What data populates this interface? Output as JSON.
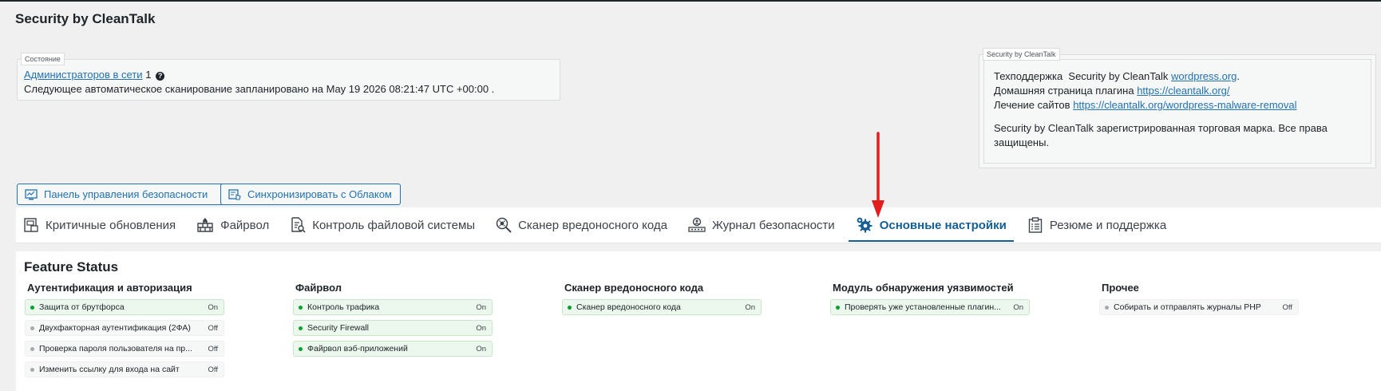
{
  "page": {
    "title": "Security by CleanTalk"
  },
  "status": {
    "legend": "Состояние",
    "admins_link": "Администраторов в сети",
    "admins_count": "1",
    "scan_text": "Следующее автоматическое сканирование запланировано на May 19 2026 08:21:47 UTC +00:00 ."
  },
  "info": {
    "legend": "Security by CleanTalk",
    "support_label": "Техподдержка  Security by CleanTalk",
    "support_link": "wordpress.org",
    "home_label": "Домашняя страница плагина",
    "home_link": "https://cleantalk.org/",
    "repair_label": "Лечение сайтов",
    "repair_link": "https://cleantalk.org/wordpress-malware-removal",
    "trademark": "Security by CleanTalk зарегистрированная торговая марка. Все права защищены."
  },
  "buttons": {
    "dashboard": "Панель управления безопасности",
    "sync": "Синхронизировать с Облаком"
  },
  "tabs": [
    {
      "label": "Критичные обновления",
      "icon": "critical-updates-icon"
    },
    {
      "label": "Файрвол",
      "icon": "firewall-icon"
    },
    {
      "label": "Контроль файловой системы",
      "icon": "file-control-icon"
    },
    {
      "label": "Сканер вредоносного кода",
      "icon": "malware-scanner-icon"
    },
    {
      "label": "Журнал безопасности",
      "icon": "security-log-icon"
    },
    {
      "label": "Основные настройки",
      "icon": "gear-icon",
      "active": true
    },
    {
      "label": "Резюме и поддержка",
      "icon": "clipboard-icon"
    }
  ],
  "features": {
    "title": "Feature Status",
    "columns": [
      {
        "title": "Аутентификация и авторизация",
        "items": [
          {
            "name": "Защита от брутфорса",
            "state": "On"
          },
          {
            "name": "Двухфакторная аутентификация (2ФА)",
            "state": "Off"
          },
          {
            "name": "Проверка пароля пользователя на пр...",
            "state": "Off"
          },
          {
            "name": "Изменить ссылку для входа на сайт",
            "state": "Off"
          }
        ]
      },
      {
        "title": "Файрвол",
        "items": [
          {
            "name": "Контроль трафика",
            "state": "On"
          },
          {
            "name": "Security Firewall",
            "state": "On"
          },
          {
            "name": "Файрвол вэб-приложений",
            "state": "On"
          }
        ]
      },
      {
        "title": "Сканер вредоносного кода",
        "items": [
          {
            "name": "Сканер вредоносного кода",
            "state": "On"
          }
        ]
      },
      {
        "title": "Модуль обнаружения уязвимостей",
        "items": [
          {
            "name": "Проверять уже установленные плагин...",
            "state": "On"
          }
        ]
      },
      {
        "title": "Прочее",
        "items": [
          {
            "name": "Собирать и отправлять журналы PHP",
            "state": "Off"
          }
        ]
      }
    ]
  },
  "colors": {
    "accent": "#2271b1",
    "active_tab": "#135e96",
    "on": "#00a32a",
    "arrow": "#e11d1d"
  }
}
